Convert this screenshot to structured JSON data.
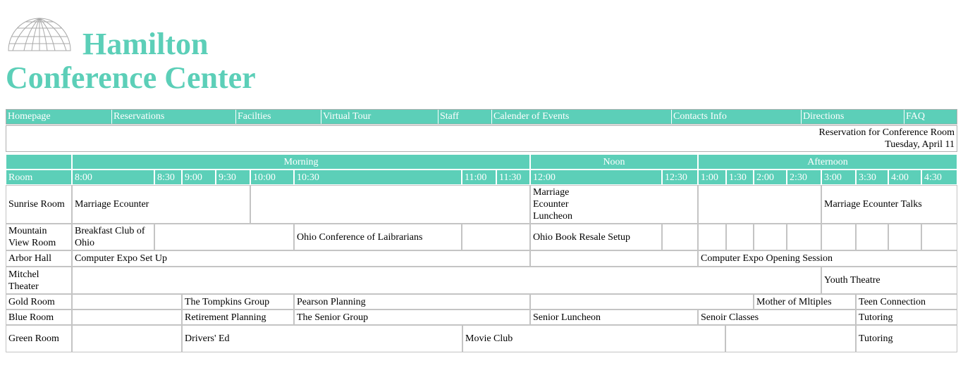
{
  "site": {
    "title_line1": "Hamilton",
    "title_line2": "Conference Center"
  },
  "nav": [
    {
      "label": "Homepage"
    },
    {
      "label": "Reservations"
    },
    {
      "label": "Facilties"
    },
    {
      "label": "Virtual Tour"
    },
    {
      "label": "Staff"
    },
    {
      "label": "Calender of Events"
    },
    {
      "label": "Contacts Info"
    },
    {
      "label": "Directions"
    },
    {
      "label": "FAQ"
    }
  ],
  "reservation": {
    "heading": "Reservation for Conference Room",
    "date": "Tuesday, April 11"
  },
  "schedule": {
    "periods": [
      "Morning",
      "Noon",
      "Afternoon"
    ],
    "room_header": "Room",
    "times": [
      "8:00",
      "8:30",
      "9:00",
      "9:30",
      "10:00",
      "10:30",
      "11:00",
      "11:30",
      "12:00",
      "12:30",
      "1:00",
      "1:30",
      "2:00",
      "2:30",
      "3:00",
      "3:30",
      "4:00",
      "4:30"
    ],
    "rooms": [
      {
        "name": "Sunrise Room",
        "events": [
          "Marriage Ecounter",
          "Marriage Ecounter Luncheon",
          "Marriage Ecounter Talks"
        ]
      },
      {
        "name": "Mountain View Room",
        "events": [
          "Breakfast Club of Ohio",
          "Ohio Conference of Laibrarians",
          "Ohio Book Resale Setup"
        ]
      },
      {
        "name": "Arbor Hall",
        "events": [
          "Computer Expo Set Up",
          "Computer Expo Opening Session"
        ]
      },
      {
        "name": "Mitchel Theater",
        "events": [
          "Youth Theatre"
        ]
      },
      {
        "name": "Gold Room",
        "events": [
          "The Tompkins Group",
          "Pearson Planning",
          "Mother of Mltiples",
          "Teen Connection"
        ]
      },
      {
        "name": "Blue Room",
        "events": [
          "Retirement Planning",
          "The Senior Group",
          "Senior Luncheon",
          "Senoir Classes",
          "Tutoring"
        ]
      },
      {
        "name": "Green Room",
        "events": [
          "Drivers' Ed",
          "Movie Club",
          "Tutoring"
        ]
      }
    ]
  }
}
